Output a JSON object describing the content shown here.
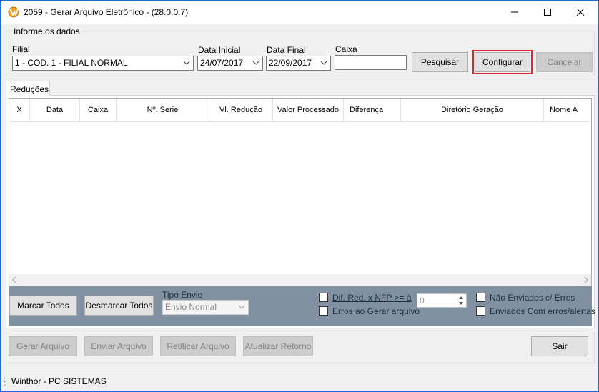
{
  "window": {
    "title": "2059 - Gerar Arquivo Eletrônico  - (28.0.0.7)",
    "controls": [
      "minimize-icon",
      "maximize-icon",
      "close-icon"
    ]
  },
  "filters": {
    "group_title": "Informe os dados",
    "filial_label": "Filial",
    "filial_value": "1 - COD. 1 - FILIAL NORMAL",
    "data_inicial_label": "Data Inicial",
    "data_inicial_value": "24/07/2017",
    "data_final_label": "Data Final",
    "data_final_value": "22/09/2017",
    "caixa_label": "Caixa",
    "caixa_value": "",
    "pesquisar_label": "Pesquisar",
    "configurar_label": "Configurar",
    "cancelar_label": "Cancelar"
  },
  "tabs": [
    {
      "label": "Reduções"
    }
  ],
  "grid": {
    "columns": [
      "X",
      "Data",
      "Caixa",
      "Nº. Serie",
      "Vl. Redução",
      "Valor Processado",
      "Diferença",
      "Diretório Geração",
      "Nome A"
    ],
    "rows": []
  },
  "options": {
    "marcar_todos_label": "Marcar Todos",
    "desmarcar_todos_label": "Desmarcar Todos",
    "tipo_envio_label": "Tipo Envio",
    "tipo_envio_value": "Envio Normal",
    "dif_red_label": "Dif. Red. x NFP  >= à",
    "dif_red_value": "0",
    "erros_gerar_label": "Erros ao Gerar arquivo",
    "nao_enviados_label": "Não Enviados c/ Erros",
    "enviados_erros_label": "Enviados Com erros/alertas"
  },
  "actions": {
    "gerar_label": "Gerar Arquivo",
    "enviar_label": "Enviar Arquivo",
    "retificar_label": "Retificar Arquivo",
    "atualizar_label": "Atualizar Retorno",
    "sair_label": "Sair"
  },
  "status": {
    "text": "Winthor - PC SISTEMAS"
  },
  "colors": {
    "highlight": "#e0252a",
    "bottom_bar": "#8291a2",
    "window_border": "#1c6fd1"
  }
}
